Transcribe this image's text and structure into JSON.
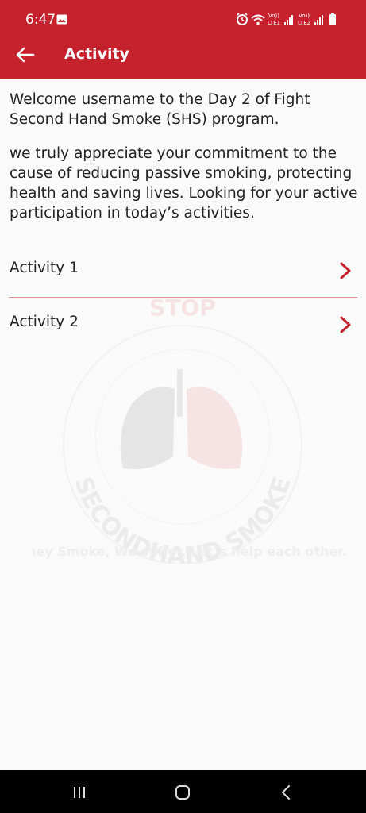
{
  "status_bar": {
    "time": "6:47",
    "icons": [
      "gallery-icon",
      "alarm-icon",
      "wifi-icon",
      "volte-lte1-icon",
      "signal-1-icon",
      "volte-lte2-icon",
      "signal-2-icon",
      "battery-icon"
    ]
  },
  "app_bar": {
    "title": "Activity",
    "back_icon": "arrow-left-icon",
    "color": "#c5222e"
  },
  "intro": {
    "welcome": "Welcome username to the Day 2 of Fight Second Hand Smoke (SHS) program.",
    "message": "we truly appreciate your commitment to the cause of reducing passive smoking, protecting health and saving lives. Looking for your active participation in today’s activities."
  },
  "activities": [
    {
      "label": "Activity 1"
    },
    {
      "label": "Activity 2"
    }
  ],
  "watermark": {
    "top_text": "STOP",
    "ring_text": "SECONDHAND SMOKE",
    "tagline": "They Smoke, We suffer. Let`s help each other."
  },
  "nav_bar": {
    "icons": [
      "recents-icon",
      "home-icon",
      "back-icon"
    ]
  }
}
